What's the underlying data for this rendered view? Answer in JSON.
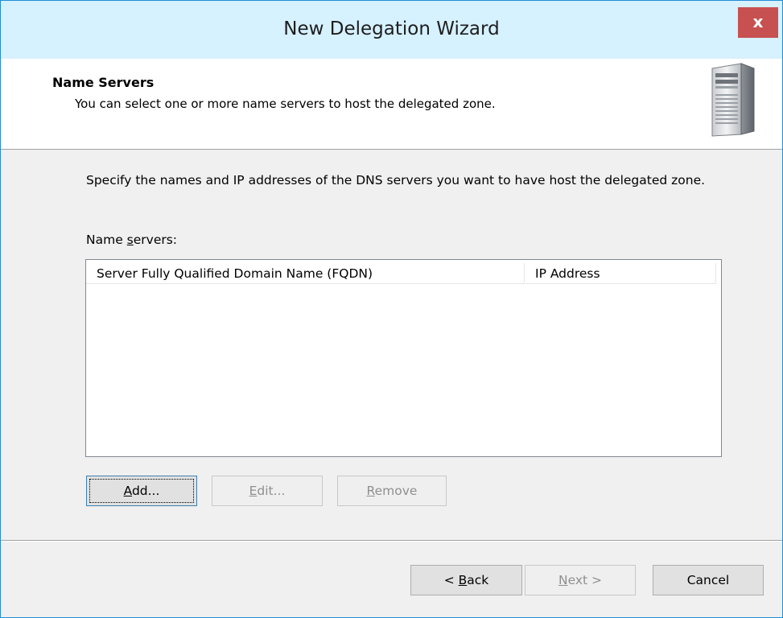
{
  "window": {
    "title": "New Delegation Wizard",
    "close_label": "x"
  },
  "header": {
    "title": "Name Servers",
    "subtitle": "You can select one or more name servers to host the delegated zone."
  },
  "body": {
    "instructions": "Specify the names and IP addresses of the DNS servers you want to have host the delegated zone.",
    "name_servers_label": "Name servers:",
    "list": {
      "columns": [
        "Server Fully Qualified Domain Name (FQDN)",
        "IP Address"
      ],
      "rows": []
    },
    "buttons": {
      "add": "Add...",
      "edit": "Edit...",
      "remove": "Remove"
    }
  },
  "footer": {
    "back": "< Back",
    "next": "Next >",
    "cancel": "Cancel"
  },
  "colors": {
    "title_bar": "#d6f1ff",
    "close_button": "#c75050",
    "window_border": "#1f8dd6"
  }
}
